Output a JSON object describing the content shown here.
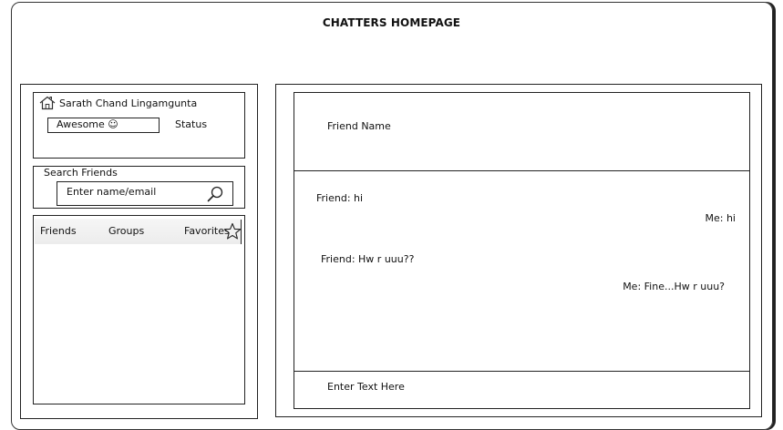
{
  "app": {
    "title": "CHATTERS HOMEPAGE"
  },
  "profile": {
    "user_name": "Sarath Chand Lingamgunta",
    "status_value": "Awesome ☺",
    "status_label": "Status"
  },
  "search": {
    "label": "Search Friends",
    "placeholder": "Enter name/email"
  },
  "tabs": [
    {
      "label": "Friends"
    },
    {
      "label": "Groups"
    },
    {
      "label": "Favorites"
    }
  ],
  "chat": {
    "friend_name": "Friend Name",
    "messages": [
      {
        "sender": "friend",
        "text": "Friend: hi"
      },
      {
        "sender": "me",
        "text": "Me: hi"
      },
      {
        "sender": "friend",
        "text": "Friend: Hw r uuu??"
      },
      {
        "sender": "me",
        "text": "Me: Fine...Hw r uuu?"
      }
    ],
    "input_placeholder": "Enter Text Here"
  },
  "icons": {
    "home": "home-icon",
    "search": "magnifier-icon",
    "favorites": "star-icon"
  }
}
